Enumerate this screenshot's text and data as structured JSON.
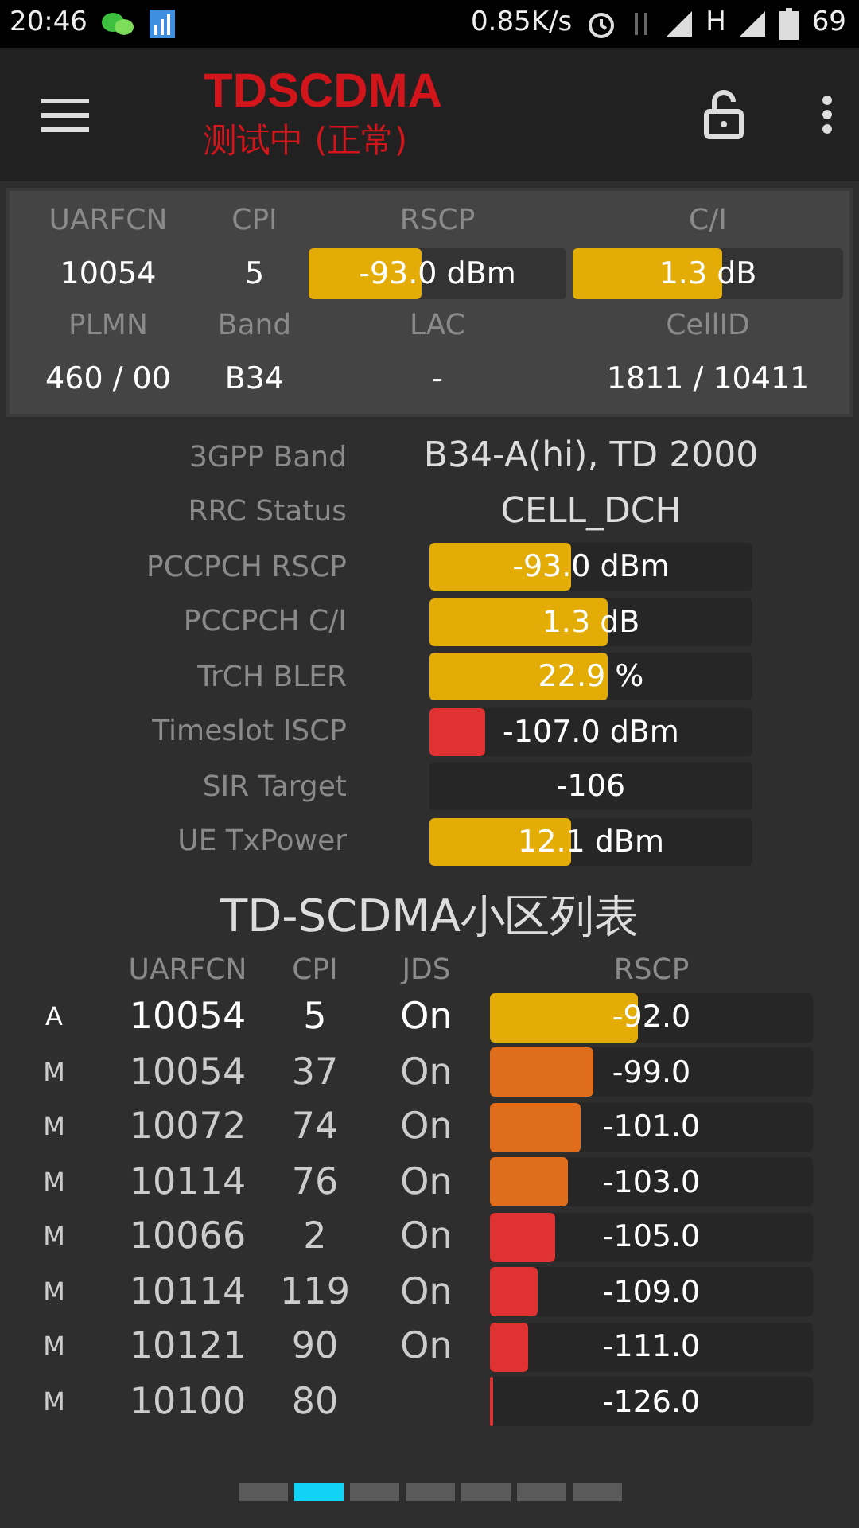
{
  "status_bar": {
    "time": "20:46",
    "speed": "0.85K/s",
    "network": "H",
    "battery": "69"
  },
  "app_bar": {
    "title": "TDSCDMA",
    "subtitle": "测试中 (正常)"
  },
  "summary": {
    "top_headers": [
      "UARFCN",
      "CPI",
      "RSCP",
      "C/I"
    ],
    "uarfcn": "10054",
    "cpi": "5",
    "rscp": {
      "reading": "-93.0 dBm",
      "level": 0.44,
      "color": "#e3ac07"
    },
    "ci": {
      "reading": "1.3 dB",
      "level": 0.55,
      "color": "#e3ac07"
    },
    "bottom_headers": [
      "PLMN",
      "Band",
      "LAC",
      "CellID"
    ],
    "bottom_values": [
      "460 / 00",
      "B34",
      "-",
      "1811 / 10411"
    ]
  },
  "info": [
    {
      "label": "3GPP Band",
      "kind": "text",
      "value": "B34-A(hi), TD 2000"
    },
    {
      "label": "RRC Status",
      "kind": "text",
      "value": "CELL_DCH"
    },
    {
      "label": "PCCPCH RSCP",
      "kind": "bar",
      "reading": "-93.0 dBm",
      "level": 0.44,
      "color": "#e3ac07"
    },
    {
      "label": "PCCPCH C/I",
      "kind": "bar",
      "reading": "1.3 dB",
      "level": 0.55,
      "color": "#e3ac07"
    },
    {
      "label": "TrCH BLER",
      "kind": "bar",
      "reading": "22.9 %",
      "level": 0.55,
      "color": "#e3ac07"
    },
    {
      "label": "Timeslot ISCP",
      "kind": "bar",
      "reading": "-107.0 dBm",
      "level": 0.17,
      "color": "#e03232"
    },
    {
      "label": "SIR Target",
      "kind": "plain",
      "reading": "-106"
    },
    {
      "label": "UE TxPower",
      "kind": "bar",
      "reading": "12.1 dBm",
      "level": 0.44,
      "color": "#e3ac07"
    }
  ],
  "cell_list": {
    "title": "TD-SCDMA小区列表",
    "columns": [
      "UARFCN",
      "CPI",
      "JDS",
      "RSCP"
    ],
    "rows": [
      {
        "type": "A",
        "active": true,
        "uarfcn": "10054",
        "cpi": "5",
        "jds": "On",
        "reading": "-92.0",
        "level": 0.46,
        "color": "#e3ac07"
      },
      {
        "type": "M",
        "active": false,
        "uarfcn": "10054",
        "cpi": "37",
        "jds": "On",
        "reading": "-99.0",
        "level": 0.32,
        "color": "#e06d1c"
      },
      {
        "type": "M",
        "active": false,
        "uarfcn": "10072",
        "cpi": "74",
        "jds": "On",
        "reading": "-101.0",
        "level": 0.28,
        "color": "#e06d1c"
      },
      {
        "type": "M",
        "active": false,
        "uarfcn": "10114",
        "cpi": "76",
        "jds": "On",
        "reading": "-103.0",
        "level": 0.24,
        "color": "#e06d1c"
      },
      {
        "type": "M",
        "active": false,
        "uarfcn": "10066",
        "cpi": "2",
        "jds": "On",
        "reading": "-105.0",
        "level": 0.2,
        "color": "#e03232"
      },
      {
        "type": "M",
        "active": false,
        "uarfcn": "10114",
        "cpi": "119",
        "jds": "On",
        "reading": "-109.0",
        "level": 0.15,
        "color": "#e03232"
      },
      {
        "type": "M",
        "active": false,
        "uarfcn": "10121",
        "cpi": "90",
        "jds": "On",
        "reading": "-111.0",
        "level": 0.12,
        "color": "#e03232"
      },
      {
        "type": "M",
        "active": false,
        "uarfcn": "10100",
        "cpi": "80",
        "reading": "-126.0",
        "level": 0.01,
        "color": "#e03232"
      }
    ]
  },
  "pager": [
    {
      "selected": false
    },
    {
      "selected": true
    },
    {
      "selected": false
    },
    {
      "selected": false
    },
    {
      "selected": false
    },
    {
      "selected": false
    },
    {
      "selected": false
    }
  ]
}
